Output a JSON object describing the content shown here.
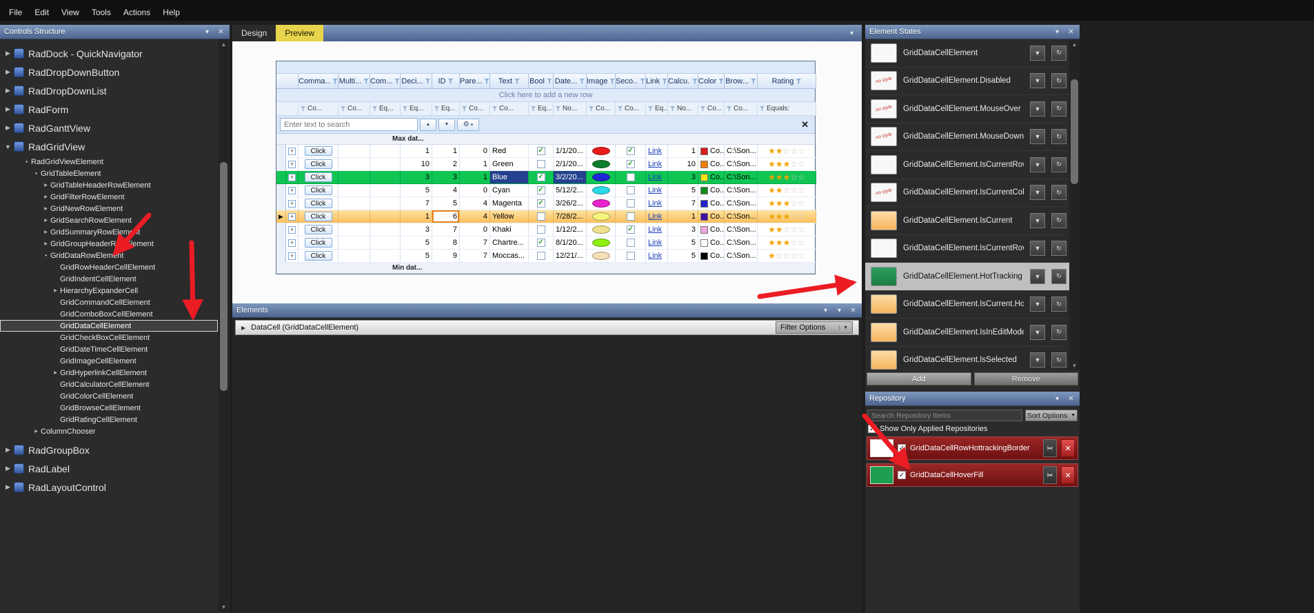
{
  "colors": {
    "caption_top": "#7e98bd",
    "caption_bottom": "#4d648f",
    "tab_active": "#e8d44c",
    "hot_row": "#0fc653",
    "current_top": "#fee2a2",
    "current_bottom": "#fabf5d",
    "selected_state": "#bfbfbf",
    "state_green": "#2d9e5e",
    "state_orange": "#f5b45e",
    "repo_top": "#9b2626",
    "repo_bottom": "#6d1111",
    "arrow": "#ec1c24"
  },
  "glyphs": {
    "chevron": "▾",
    "chevron_small": "▾",
    "close": "✕",
    "up": "▲",
    "down": "▼",
    "right": "▶",
    "expanded": "▼",
    "dot": "●",
    "gear": "⚙",
    "star": "★",
    "star_empty": "☆",
    "check": "✓",
    "plus": "+",
    "refresh": "↻",
    "dropdown": "▼",
    "scissors": "✂",
    "arrow_current": "▶"
  },
  "menu_bar": {
    "items": [
      "File",
      "Edit",
      "View",
      "Tools",
      "Actions",
      "Help"
    ]
  },
  "controls_panel": {
    "title": "Controls Structure",
    "tree": [
      {
        "label": "RadDock - QuickNavigator",
        "level": 0,
        "big": true,
        "exp": "collapsed",
        "selected": false
      },
      {
        "label": "RadDropDownButton",
        "level": 0,
        "big": true,
        "exp": "collapsed",
        "selected": false
      },
      {
        "label": "RadDropDownList",
        "level": 0,
        "big": true,
        "exp": "collapsed",
        "selected": false
      },
      {
        "label": "RadForm",
        "level": 0,
        "big": true,
        "exp": "collapsed",
        "selected": false
      },
      {
        "label": "RadGanttView",
        "level": 0,
        "big": true,
        "exp": "collapsed",
        "selected": false
      },
      {
        "label": "RadGridView",
        "level": 0,
        "big": true,
        "exp": "expanded",
        "selected": false
      },
      {
        "label": "RadGridViewElement",
        "level": 1,
        "big": false,
        "exp": "expanded",
        "selected": false
      },
      {
        "label": "GridTableElement",
        "level": 2,
        "big": false,
        "exp": "expanded",
        "selected": false
      },
      {
        "label": "GridTableHeaderRowElement",
        "level": 3,
        "big": false,
        "exp": "collapsed",
        "selected": false
      },
      {
        "label": "GridFilterRowElement",
        "level": 3,
        "big": false,
        "exp": "collapsed",
        "selected": false
      },
      {
        "label": "GridNewRowElement",
        "level": 3,
        "big": false,
        "exp": "collapsed",
        "selected": false
      },
      {
        "label": "GridSearchRowElement",
        "level": 3,
        "big": false,
        "exp": "collapsed",
        "selected": false
      },
      {
        "label": "GridSummaryRowElement",
        "level": 3,
        "big": false,
        "exp": "collapsed",
        "selected": false
      },
      {
        "label": "GridGroupHeaderRowElement",
        "level": 3,
        "big": false,
        "exp": "collapsed",
        "selected": false
      },
      {
        "label": "GridDataRowElement",
        "level": 3,
        "big": false,
        "exp": "expanded",
        "selected": false
      },
      {
        "label": "GridRowHeaderCellElement",
        "level": 4,
        "big": false,
        "exp": "none",
        "selected": false
      },
      {
        "label": "GridIndentCellElement",
        "level": 4,
        "big": false,
        "exp": "none",
        "selected": false
      },
      {
        "label": "HierarchyExpanderCell",
        "level": 4,
        "big": false,
        "exp": "collapsed",
        "selected": false
      },
      {
        "label": "GridCommandCellElement",
        "level": 4,
        "big": false,
        "exp": "none",
        "selected": false
      },
      {
        "label": "GridComboBoxCellElement",
        "level": 4,
        "big": false,
        "exp": "none",
        "selected": false
      },
      {
        "label": "GridDataCellElement",
        "level": 4,
        "big": false,
        "exp": "none",
        "selected": true
      },
      {
        "label": "GridCheckBoxCellElement",
        "level": 4,
        "big": false,
        "exp": "none",
        "selected": false
      },
      {
        "label": "GridDateTimeCellElement",
        "level": 4,
        "big": false,
        "exp": "none",
        "selected": false
      },
      {
        "label": "GridImageCellElement",
        "level": 4,
        "big": false,
        "exp": "none",
        "selected": false
      },
      {
        "label": "GridHyperlinkCellElement",
        "level": 4,
        "big": false,
        "exp": "collapsed",
        "selected": false
      },
      {
        "label": "GridCalculatorCellElement",
        "level": 4,
        "big": false,
        "exp": "none",
        "selected": false
      },
      {
        "label": "GridColorCellElement",
        "level": 4,
        "big": false,
        "exp": "none",
        "selected": false
      },
      {
        "label": "GridBrowseCellElement",
        "level": 4,
        "big": false,
        "exp": "none",
        "selected": false
      },
      {
        "label": "GridRatingCellElement",
        "level": 4,
        "big": false,
        "exp": "none",
        "selected": false
      },
      {
        "label": "ColumnChooser",
        "level": 2,
        "big": false,
        "exp": "collapsed",
        "selected": false
      },
      {
        "label": "RadGroupBox",
        "level": 0,
        "big": true,
        "exp": "collapsed",
        "selected": false,
        "gap": true
      },
      {
        "label": "RadLabel",
        "level": 0,
        "big": true,
        "exp": "collapsed",
        "selected": false
      },
      {
        "label": "RadLayoutControl",
        "level": 0,
        "big": true,
        "exp": "collapsed",
        "selected": false
      }
    ]
  },
  "design_tabs": {
    "tabs": [
      {
        "label": "Design",
        "active": false
      },
      {
        "label": "Preview",
        "active": true
      }
    ]
  },
  "grid": {
    "add_row_text": "Click here to add a new row",
    "search_placeholder": "Enter text to search",
    "top_group_text": "Max dat...",
    "bottom_group_text": "Min dat...",
    "columns": [
      {
        "name": "Comma...",
        "filter": "Co...",
        "key": "command"
      },
      {
        "name": "Multi...",
        "filter": "Co...",
        "key": "multi"
      },
      {
        "name": "Com...",
        "filter": "Eq...",
        "key": "com"
      },
      {
        "name": "Deci...",
        "filter": "Eq...",
        "key": "deci"
      },
      {
        "name": "ID",
        "filter": "Eq...",
        "key": "id"
      },
      {
        "name": "Pare...",
        "filter": "Co...",
        "key": "pare"
      },
      {
        "name": "Text",
        "filter": "Co...",
        "key": "text"
      },
      {
        "name": "Bool",
        "filter": "Eq...",
        "key": "bool"
      },
      {
        "name": "Date...",
        "filter": "No...",
        "key": "date"
      },
      {
        "name": "Image",
        "filter": "Co...",
        "key": "image"
      },
      {
        "name": "Seco...",
        "filter": "Co...",
        "key": "seco"
      },
      {
        "name": "Link",
        "filter": "Eq...",
        "key": "link"
      },
      {
        "name": "Calcu...",
        "filter": "No...",
        "key": "calcu"
      },
      {
        "name": "Color",
        "filter": "Co...",
        "key": "color"
      },
      {
        "name": "Brow...",
        "filter": "Co...",
        "key": "brow"
      },
      {
        "name": "Rating",
        "filter": "Equals:",
        "key": "rating"
      }
    ],
    "rows": [
      {
        "command": "Click",
        "deci": 1,
        "id": 1,
        "pare": 0,
        "text": "Red",
        "bool": true,
        "date": "1/1/20...",
        "image": "#e81c1c",
        "seco": true,
        "link": "Link",
        "calcu": 1,
        "color": "#d81e1e",
        "color_text": "Co...",
        "brow": "C:\\Son...",
        "rating": 2,
        "state": "normal"
      },
      {
        "command": "Click",
        "deci": 10,
        "id": 2,
        "pare": 1,
        "text": "Green",
        "bool": false,
        "date": "2/1/20...",
        "image": "#0e7d2a",
        "seco": true,
        "link": "Link",
        "calcu": 10,
        "color": "#f07f00",
        "color_text": "Co...",
        "brow": "C:\\Son...",
        "rating": 3,
        "state": "normal"
      },
      {
        "command": "Click",
        "deci": 3,
        "id": 3,
        "pare": 1,
        "text": "Blue",
        "bool": true,
        "date": "3/2/20...",
        "image": "#2026d8",
        "seco": false,
        "link": "Link",
        "calcu": 3,
        "color": "#f2e50e",
        "color_text": "Co...",
        "brow": "C:\\Son...",
        "rating": 3,
        "state": "hot"
      },
      {
        "command": "Click",
        "deci": 5,
        "id": 4,
        "pare": 0,
        "text": "Cyan",
        "bool": true,
        "date": "5/12/2...",
        "image": "#2bd9e9",
        "seco": false,
        "link": "Link",
        "calcu": 5,
        "color": "#118a1c",
        "color_text": "Co...",
        "brow": "C:\\Son...",
        "rating": 2,
        "state": "normal"
      },
      {
        "command": "Click",
        "deci": 7,
        "id": 5,
        "pare": 4,
        "text": "Magenta",
        "bool": true,
        "date": "3/26/2...",
        "image": "#e822cc",
        "seco": false,
        "link": "Link",
        "calcu": 7,
        "color": "#2121c8",
        "color_text": "Co...",
        "brow": "C:\\Son...",
        "rating": 3,
        "state": "normal"
      },
      {
        "command": "Click",
        "deci": 1,
        "id": 6,
        "pare": 4,
        "text": "Yellow",
        "bool": false,
        "date": "7/28/2...",
        "image": "#f6f67c",
        "seco": false,
        "link": "Link",
        "calcu": 1,
        "color": "#41109d",
        "color_text": "Co...",
        "brow": "C:\\Son...",
        "rating": 3,
        "state": "current"
      },
      {
        "command": "Click",
        "deci": 3,
        "id": 7,
        "pare": 0,
        "text": "Khaki",
        "bool": false,
        "date": "1/12/2...",
        "image": "#efe28c",
        "seco": true,
        "link": "Link",
        "calcu": 3,
        "color": "#f0a6df",
        "color_text": "Co...",
        "brow": "C:\\Son...",
        "rating": 2,
        "state": "normal"
      },
      {
        "command": "Click",
        "deci": 5,
        "id": 8,
        "pare": 7,
        "text": "Chartre...",
        "bool": true,
        "date": "8/1/20...",
        "image": "#8df011",
        "seco": false,
        "link": "Link",
        "calcu": 5,
        "color": "#ffffff",
        "color_text": "Co...",
        "brow": "C:\\Son...",
        "rating": 3,
        "state": "normal"
      },
      {
        "command": "Click",
        "deci": 5,
        "id": 9,
        "pare": 7,
        "text": "Moccas...",
        "bool": false,
        "date": "12/21/...",
        "image": "#f5dfb4",
        "seco": false,
        "link": "Link",
        "calcu": 5,
        "color": "#000000",
        "color_text": "Co...",
        "brow": "C:\\Son...",
        "rating": 1,
        "state": "normal"
      }
    ]
  },
  "elements_panel": {
    "title": "Elements",
    "item": "DataCell (GridDataCellElement)",
    "filter_button": "Filter Options"
  },
  "element_states": {
    "title": "Element States",
    "nostyle_text": "no style",
    "add_label": "Add",
    "remove_label": "Remove",
    "items": [
      {
        "label": "GridDataCellElement",
        "thumb": "plain",
        "selected": false
      },
      {
        "label": "GridDataCellElement.Disabled",
        "thumb": "nostyle",
        "selected": false
      },
      {
        "label": "GridDataCellElement.MouseOver",
        "thumb": "nostyle",
        "selected": false
      },
      {
        "label": "GridDataCellElement.MouseDown",
        "thumb": "nostyle",
        "selected": false
      },
      {
        "label": "GridDataCellElement.IsCurrentRow",
        "thumb": "plain",
        "selected": false
      },
      {
        "label": "GridDataCellElement.IsCurrentColumn",
        "thumb": "nostyle",
        "selected": false
      },
      {
        "label": "GridDataCellElement.IsCurrent",
        "thumb": "orange",
        "selected": false
      },
      {
        "label": "GridDataCellElement.IsCurrentRow.HotTrac...",
        "thumb": "plain",
        "selected": false
      },
      {
        "label": "GridDataCellElement.HotTracking",
        "thumb": "green",
        "selected": true
      },
      {
        "label": "GridDataCellElement.IsCurrent.HotTracking",
        "thumb": "orange",
        "selected": false
      },
      {
        "label": "GridDataCellElement.IsInEditMode",
        "thumb": "orange",
        "selected": false
      },
      {
        "label": "GridDataCellElement.IsSelected",
        "thumb": "orange",
        "selected": false
      }
    ]
  },
  "repository": {
    "title": "Repository",
    "search_placeholder": "Search Repository Items",
    "sort_button": "Sort Options",
    "checkbox_label": "Show Only Applied Repositories",
    "items": [
      {
        "label": "GridDataCellRowHottrackingBorder",
        "swatch": "#ffffff",
        "checked": true
      },
      {
        "label": "GridDataCellHoverFill",
        "swatch": "#1e9e50",
        "checked": true
      }
    ]
  }
}
